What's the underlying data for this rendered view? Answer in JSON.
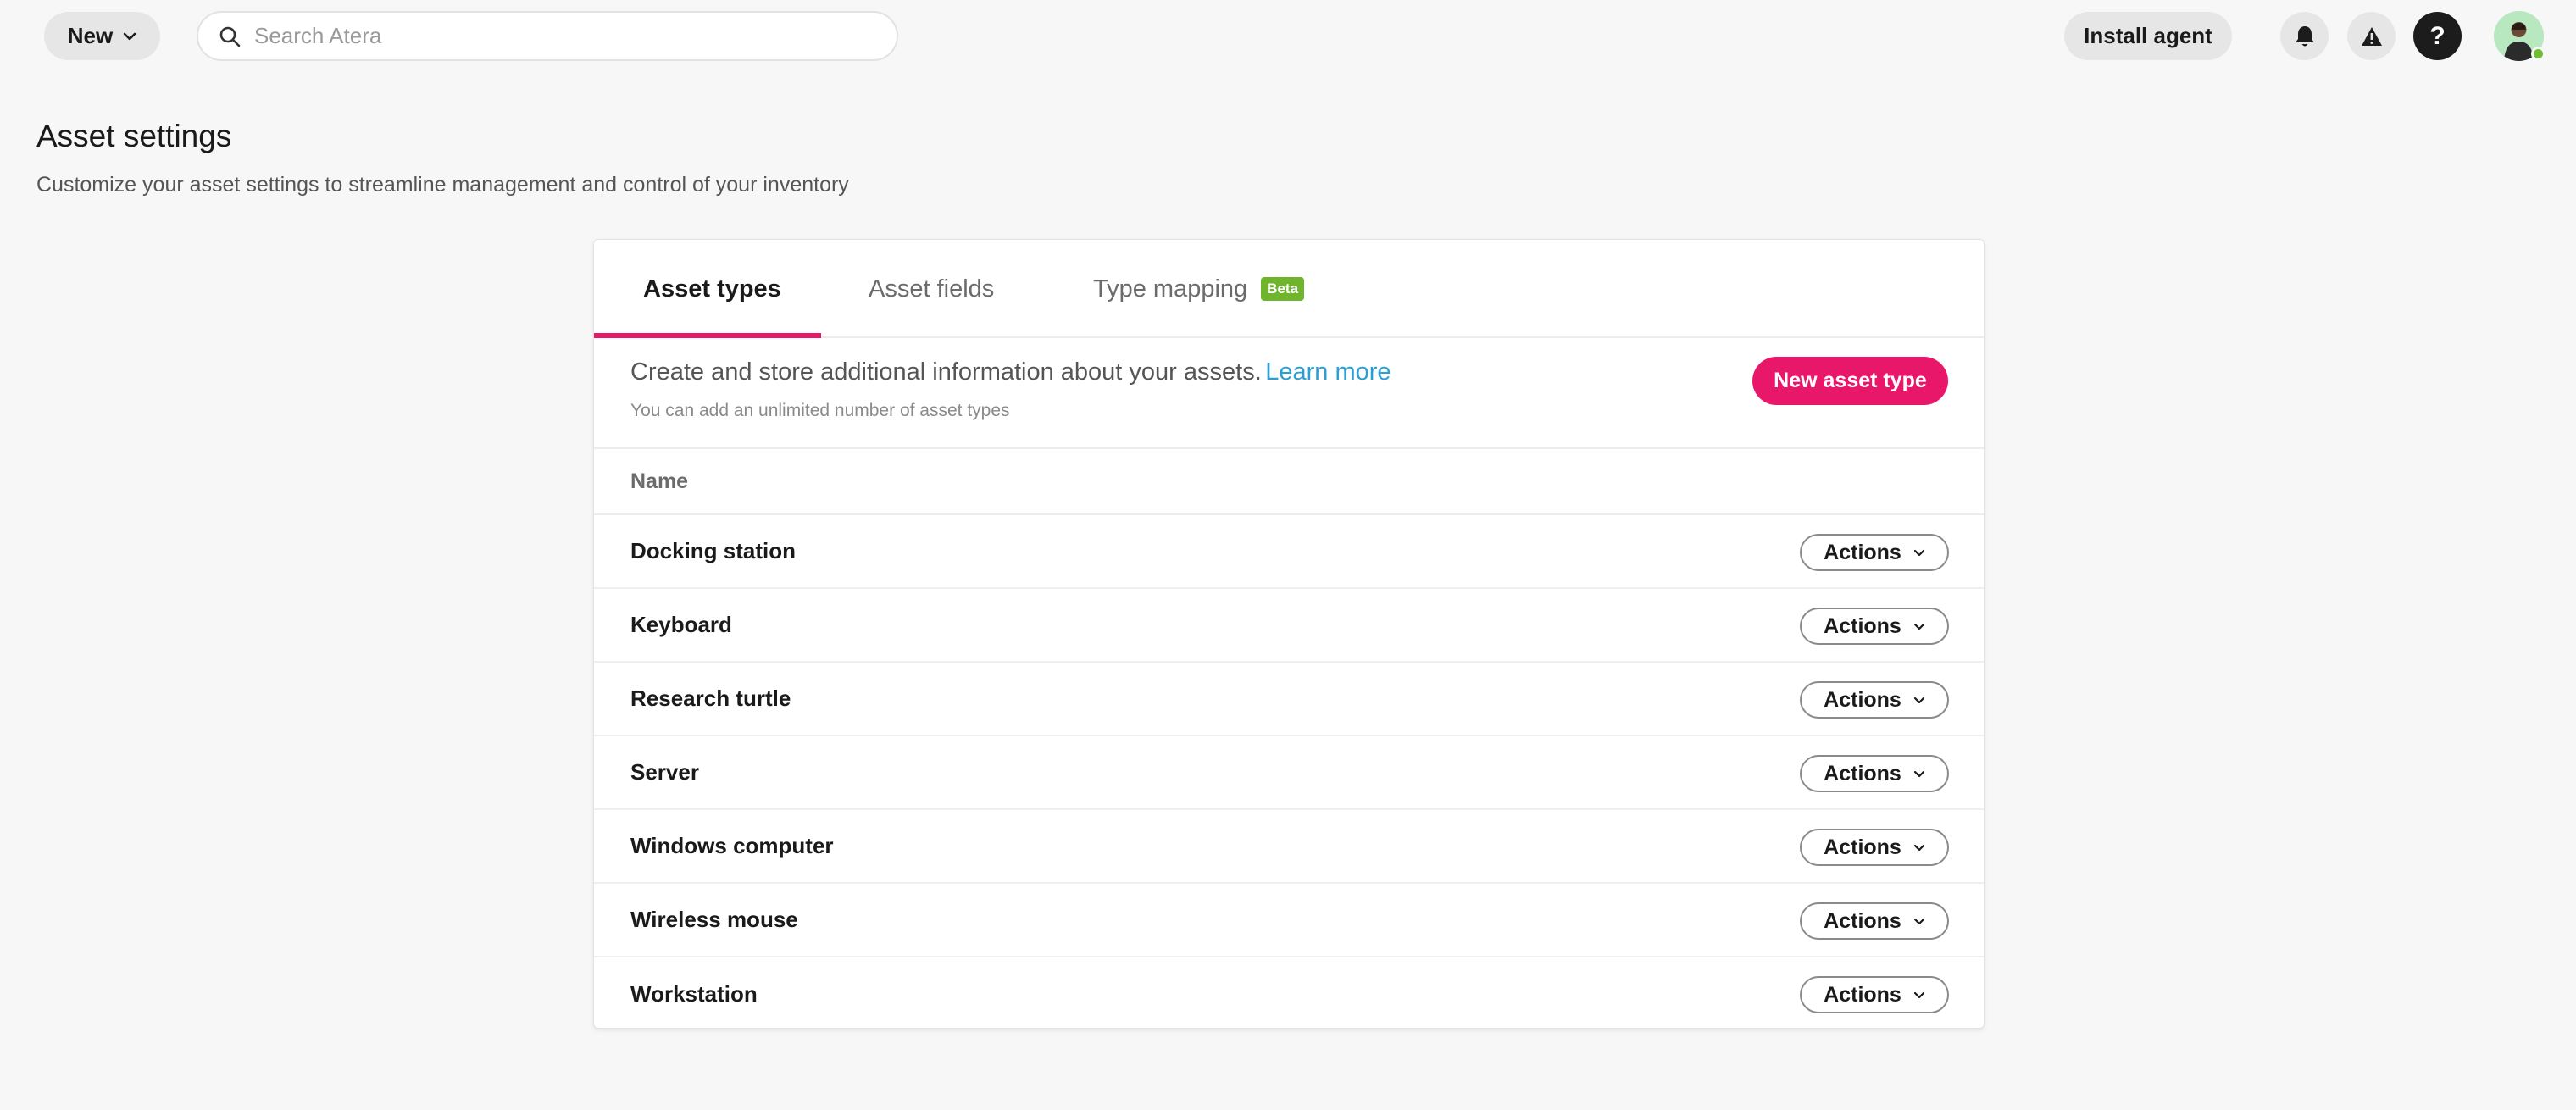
{
  "topbar": {
    "new_label": "New",
    "search_placeholder": "Search Atera",
    "install_agent_label": "Install agent",
    "help_label": "?",
    "icons": [
      "chevron-down-icon",
      "search-icon",
      "bell-icon",
      "warning-icon",
      "help-icon",
      "avatar"
    ],
    "status_color": "#6fbe2f"
  },
  "page": {
    "title": "Asset settings",
    "subtitle": "Customize your asset settings to streamline management and control of your inventory"
  },
  "tabs": [
    {
      "label": "Asset types",
      "active": true
    },
    {
      "label": "Asset fields",
      "active": false
    },
    {
      "label": "Type mapping",
      "active": false,
      "badge": "Beta"
    }
  ],
  "intro": {
    "text": "Create and store additional information about your assets.",
    "link": "Learn more",
    "sub": "You can add an unlimited number of asset types",
    "button": "New asset type"
  },
  "table": {
    "header": "Name",
    "action_label": "Actions",
    "rows": [
      "Docking station",
      "Keyboard",
      "Research turtle",
      "Server",
      "Windows computer",
      "Wireless mouse",
      "Workstation"
    ]
  },
  "colors": {
    "accent": "#e8176a",
    "link": "#2a9fd6",
    "beta": "#6fb52c"
  }
}
